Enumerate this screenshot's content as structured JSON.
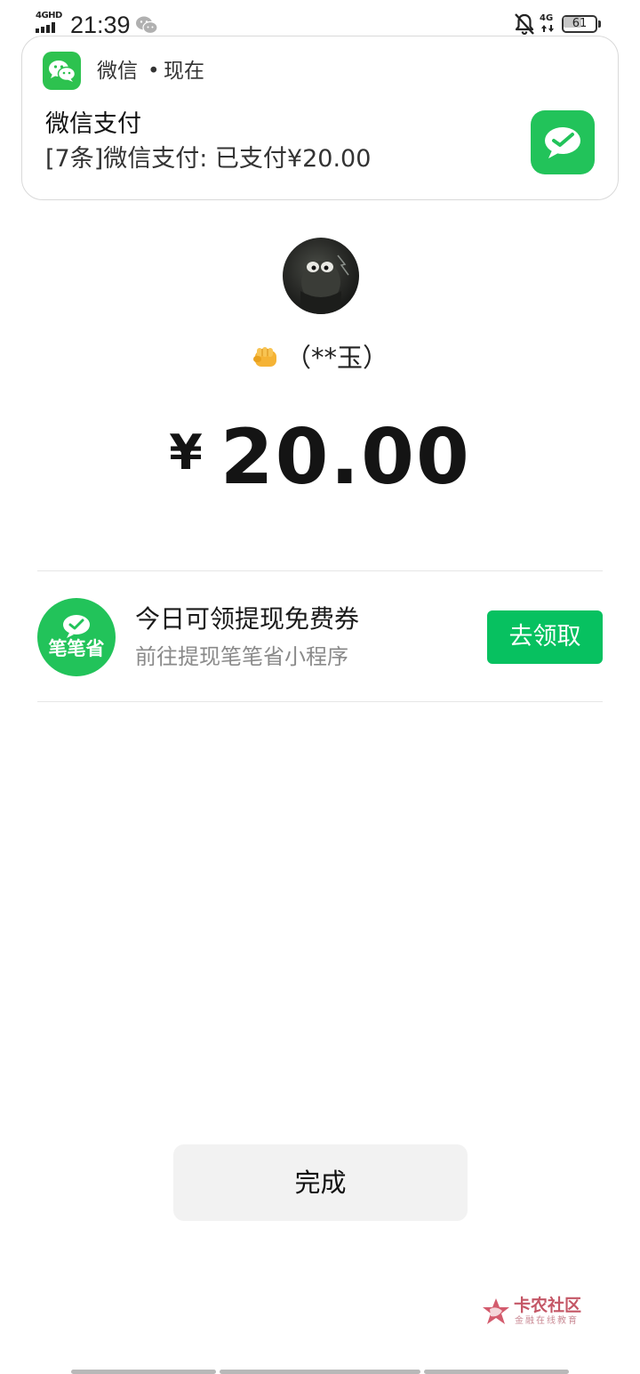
{
  "status_bar": {
    "network_label": "4GHD",
    "time": "21:39",
    "mobile_data_label": "4G",
    "battery_level": "61",
    "battery_fraction": 0.61,
    "icons": [
      "signal-icon",
      "wechat-status-icon",
      "mute-icon",
      "mobile-data-icon",
      "battery-icon"
    ]
  },
  "notification": {
    "app_name": "微信",
    "separator": "•",
    "time": "现在",
    "title": "微信支付",
    "body": "[7条]微信支付: 已支付¥20.00",
    "icon": "wechat-pay-icon",
    "app_icon": "wechat-icon",
    "accent_color": "#22c35a"
  },
  "payment": {
    "payee": "（**玉）",
    "payee_emoji_icon": "fist-icon",
    "currency": "¥",
    "amount": "20.00"
  },
  "promo": {
    "logo_text": "笔笔省",
    "title": "今日可领提现免费券",
    "subtitle": "前往提现笔笔省小程序",
    "button_label": "去领取",
    "button_color": "#07c160"
  },
  "done_button": "完成",
  "watermark": {
    "title": "卡农社区",
    "subtitle": "金融在线教育",
    "icon": "kanong-logo-icon"
  }
}
